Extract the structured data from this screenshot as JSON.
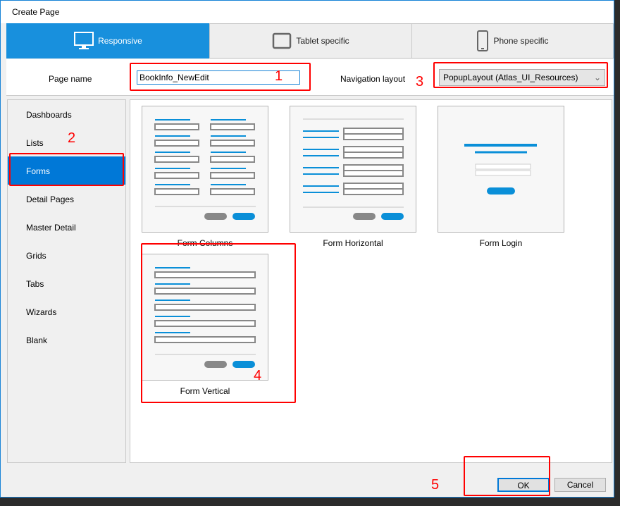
{
  "window": {
    "title": "Create Page"
  },
  "tabs": [
    {
      "label": "Responsive",
      "icon": "monitor-icon",
      "active": true
    },
    {
      "label": "Tablet specific",
      "icon": "tablet-icon"
    },
    {
      "label": "Phone specific",
      "icon": "phone-icon"
    }
  ],
  "form": {
    "page_name_label": "Page name",
    "page_name_value": "BookInfo_NewEdit",
    "nav_layout_label": "Navigation layout",
    "nav_layout_value": "PopupLayout (Atlas_UI_Resources)"
  },
  "sidebar": {
    "items": [
      {
        "label": "Dashboards"
      },
      {
        "label": "Lists"
      },
      {
        "label": "Forms",
        "selected": true
      },
      {
        "label": "Detail Pages"
      },
      {
        "label": "Master Detail"
      },
      {
        "label": "Grids"
      },
      {
        "label": "Tabs"
      },
      {
        "label": "Wizards"
      },
      {
        "label": "Blank"
      }
    ]
  },
  "templates": [
    {
      "label": "Form Columns"
    },
    {
      "label": "Form Horizontal"
    },
    {
      "label": "Form Login"
    },
    {
      "label": "Form Vertical"
    }
  ],
  "footer": {
    "ok": "OK",
    "cancel": "Cancel"
  },
  "annotations": [
    "1",
    "2",
    "3",
    "4",
    "5"
  ],
  "colors": {
    "accent": "#1890dd",
    "selected": "#0078d7",
    "annotation": "#ff0000"
  }
}
